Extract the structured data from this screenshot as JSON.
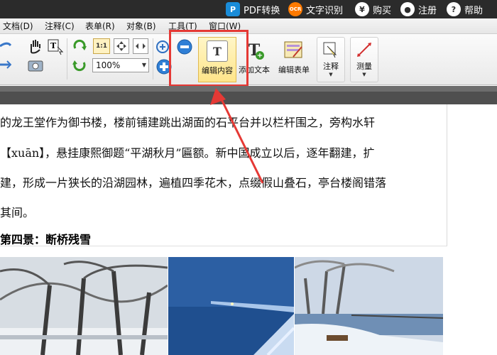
{
  "topbar": {
    "items": [
      {
        "icon": "pdf-convert-icon",
        "glyph": "P",
        "label": "PDF转换"
      },
      {
        "icon": "ocr-icon",
        "glyph": "OCR",
        "label": "文字识别"
      },
      {
        "icon": "yen-icon",
        "glyph": "¥",
        "label": "购买"
      },
      {
        "icon": "user-icon",
        "glyph": "●",
        "label": "注册"
      },
      {
        "icon": "help-icon",
        "glyph": "?",
        "label": "帮助"
      }
    ]
  },
  "menubar": {
    "items": [
      "文档(D)",
      "注释(C)",
      "表单(R)",
      "对象(B)",
      "工具(T)",
      "窗口(W)"
    ]
  },
  "toolbar": {
    "zoom_value": "100%",
    "edit_content_label": "编辑内容",
    "add_text_label": "添加文本",
    "edit_form_label": "编辑表单",
    "comment_label": "注释",
    "measure_label": "测量",
    "actual_size_label": "1:1",
    "edit_content_glyph": "T",
    "add_text_glyph": "T"
  },
  "document": {
    "lines": [
      "的龙王堂作为御书楼，楼前铺建跳出湖面的石平台并以栏杆围之，旁构水轩",
      "【xuān】，悬挂康熙御题“平湖秋月”匾额。新中国成立以后，逐年翻建，扩",
      "建，形成一片狭长的沿湖园林，遍植四季花木，点缀假山叠石，亭台楼阁错落",
      "其间。"
    ],
    "heading": "第四景：断桥残雪"
  },
  "colors": {
    "highlight_box": "#e53935",
    "active_tool_bg": "#ffe58a"
  }
}
